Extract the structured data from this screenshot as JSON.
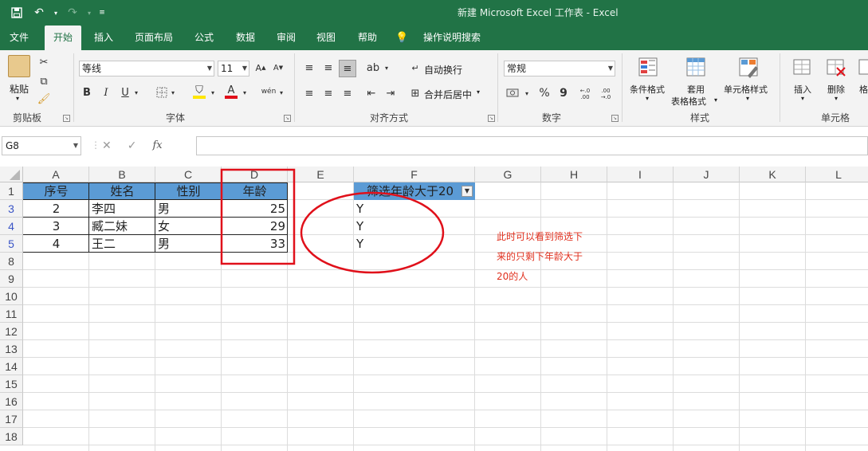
{
  "window_title": "新建 Microsoft Excel 工作表  -  Excel",
  "qat": {
    "save_icon": "save-icon",
    "undo_icon": "undo-icon",
    "redo_icon": "redo-icon"
  },
  "menu_tabs": [
    "文件",
    "开始",
    "插入",
    "页面布局",
    "公式",
    "数据",
    "审阅",
    "视图",
    "帮助",
    "操作说明搜索"
  ],
  "active_tab": "开始",
  "ribbon": {
    "clipboard": {
      "paste": "粘贴",
      "label": "剪贴板"
    },
    "font": {
      "name": "等线",
      "size": "11",
      "label": "字体",
      "bold": "B",
      "italic": "I",
      "underline": "U",
      "phonetic": "wén"
    },
    "alignment": {
      "wrap": "自动换行",
      "merge": "合并后居中",
      "label": "对齐方式"
    },
    "number": {
      "format": "常规",
      "label": "数字",
      "percent": "%",
      "comma": "9",
      "inc": "←.0 .00",
      "dec": ".00 →.0"
    },
    "styles": {
      "conditional": "条件格式",
      "table_line1": "套用",
      "table_line2": "表格格式",
      "cell_styles": "单元格样式",
      "label": "样式"
    },
    "cells": {
      "insert": "插入",
      "delete": "删除",
      "format": "格",
      "label": "单元格"
    }
  },
  "formula_bar": {
    "name_box": "G8",
    "cancel": "✕",
    "enter": "✓",
    "fx": "fx",
    "value": ""
  },
  "columns": [
    "A",
    "B",
    "C",
    "D",
    "E",
    "F",
    "G",
    "H",
    "I",
    "J",
    "K",
    "L"
  ],
  "rows": [
    "1",
    "3",
    "4",
    "5",
    "8",
    "9",
    "10",
    "11",
    "12",
    "13",
    "14",
    "15",
    "16",
    "17",
    "18"
  ],
  "table": {
    "headers": [
      "序号",
      "姓名",
      "性别",
      "年龄"
    ],
    "rows": [
      [
        "2",
        "李四",
        "男",
        "25"
      ],
      [
        "3",
        "臧二妹",
        "女",
        "29"
      ],
      [
        "4",
        "王二",
        "男",
        "33"
      ]
    ]
  },
  "filter_column": {
    "header": "筛选年龄大于20",
    "values": [
      "Y",
      "Y",
      "Y"
    ]
  },
  "annotation": {
    "line1": "此时可以看到筛选下",
    "line2": "来的只剩下年龄大于",
    "line3": "20的人"
  },
  "colors": {
    "excel_green": "#217346",
    "header_blue": "#5b9bd5",
    "annotation_red": "#e0301e"
  }
}
